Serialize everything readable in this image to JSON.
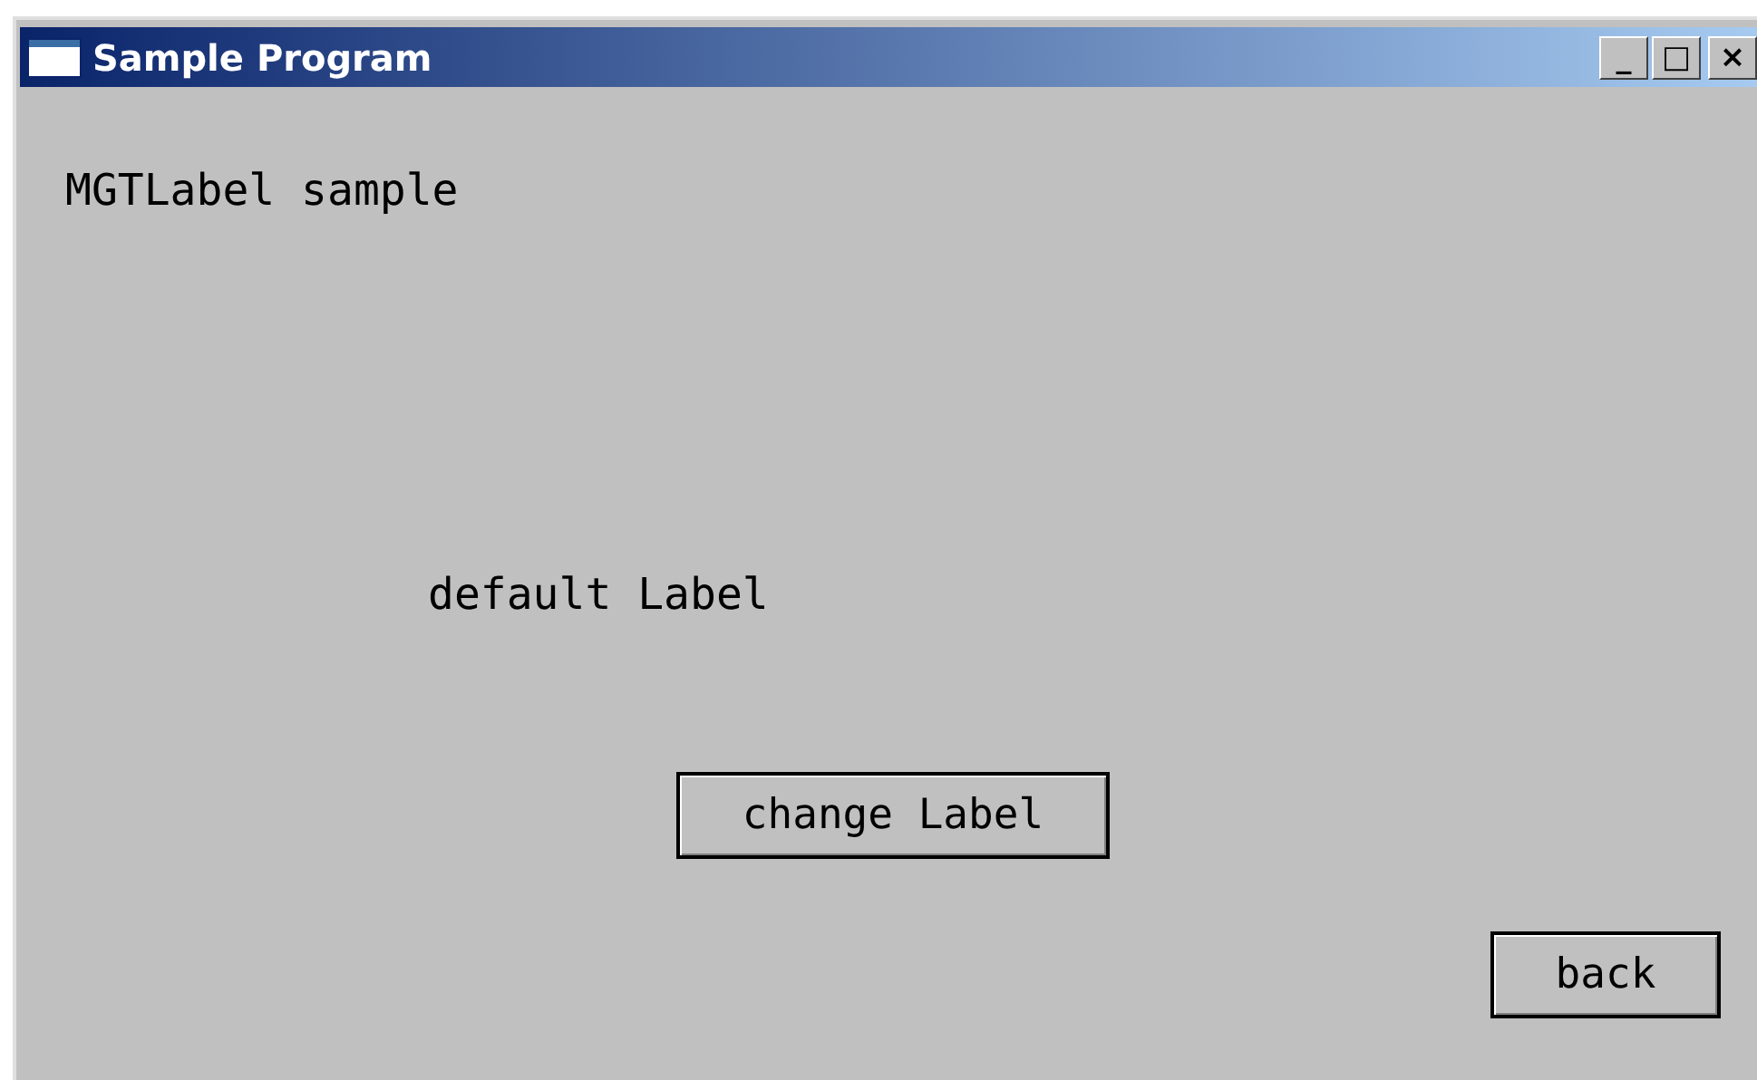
{
  "window": {
    "title": "Sample Program",
    "controls": [
      "_",
      "□",
      "×"
    ]
  },
  "heading": "MGTLabel sample",
  "label": "default Label",
  "buttons": [
    {
      "kind": "change",
      "label": "change Label"
    },
    {
      "kind": "back",
      "label": "back"
    }
  ]
}
